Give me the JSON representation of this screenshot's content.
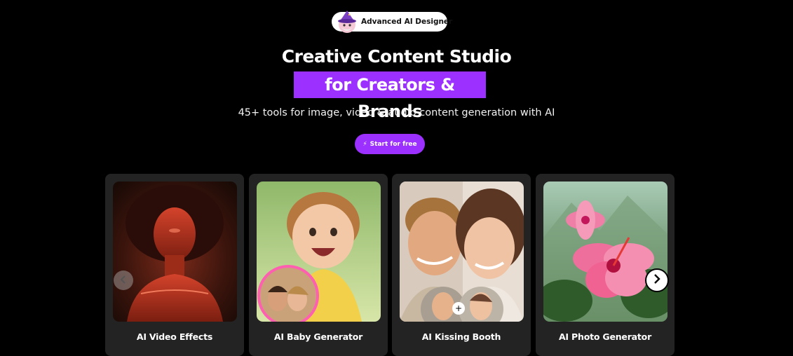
{
  "badge": {
    "text": "Advanced AI Designer",
    "avatar_icon": "wizard-avatar-icon"
  },
  "hero": {
    "title": "Creative Content Studio",
    "highlight": "for Creators & Brands",
    "subtitle": "45+ tools for image, video & audio content generation with AI",
    "cta_label": "Start for free",
    "cta_icon": "lightning-icon"
  },
  "carousel": {
    "prev_icon": "chevron-left-icon",
    "next_icon": "chevron-right-icon",
    "cards": [
      {
        "label": "AI Video Effects"
      },
      {
        "label": "AI Baby Generator"
      },
      {
        "label": "AI Kissing Booth"
      },
      {
        "label": "AI Photo Generator"
      }
    ]
  },
  "colors": {
    "accent": "#9b30ff",
    "background": "#000000",
    "card": "#232323"
  }
}
